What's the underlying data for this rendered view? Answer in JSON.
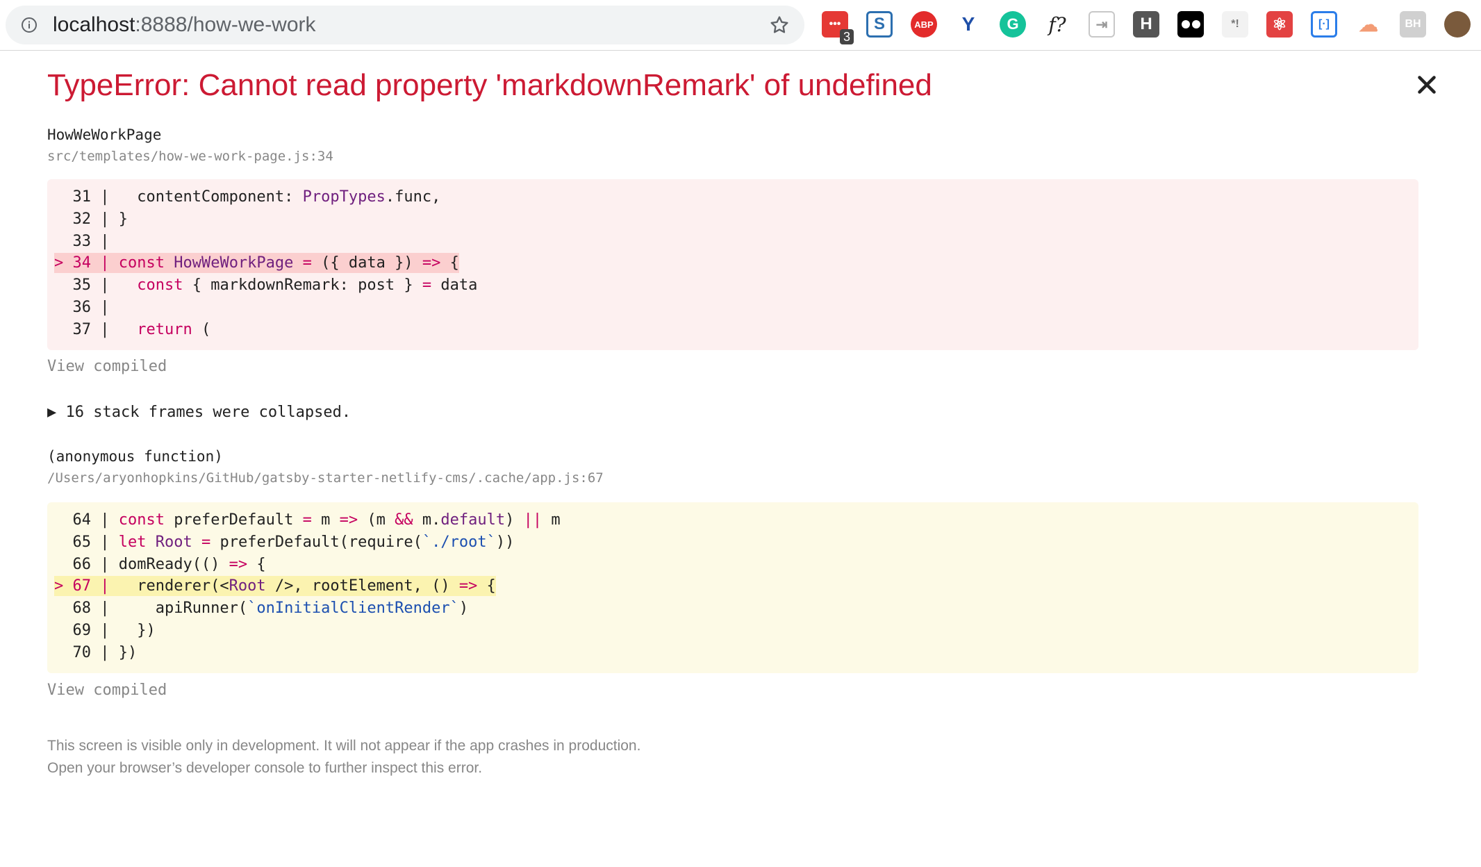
{
  "browser": {
    "url_host": "localhost",
    "url_rest": ":8888/how-we-work",
    "extension_badge": "3",
    "extensions": [
      "ext-meetup-icon",
      "ext-s-icon",
      "ext-abp-icon",
      "ext-y-icon",
      "ext-grammarly-icon",
      "ext-f-icon",
      "ext-arrow-icon",
      "ext-h-icon",
      "ext-tampermonkey-icon",
      "ext-regex-icon",
      "ext-react-icon",
      "ext-bracket-icon",
      "ext-cloud-icon",
      "ext-bh-icon",
      "ext-avatar-icon"
    ],
    "labels": {
      "abp": "ABP",
      "f": "f?",
      "h": "H",
      "regex": "*!",
      "bh": "BH"
    }
  },
  "error": {
    "title": "TypeError: Cannot read property 'markdownRemark' of undefined",
    "close_label": "×"
  },
  "frames": [
    {
      "function": "HowWeWorkPage",
      "path": "src/templates/how-we-work-page.js:34",
      "view_compiled": "View compiled",
      "lines": [
        {
          "num": "31",
          "marker": " ",
          "code": "   contentComponent: PropTypes.func,"
        },
        {
          "num": "32",
          "marker": " ",
          "code": " }"
        },
        {
          "num": "33",
          "marker": " ",
          "code": ""
        },
        {
          "num": "34",
          "marker": ">",
          "code": " const HowWeWorkPage = ({ data }) => {"
        },
        {
          "num": "35",
          "marker": " ",
          "code": "   const { markdownRemark: post } = data"
        },
        {
          "num": "36",
          "marker": " ",
          "code": ""
        },
        {
          "num": "37",
          "marker": " ",
          "code": "   return ("
        }
      ]
    },
    {
      "function": "(anonymous function)",
      "path": "/Users/aryonhopkins/GitHub/gatsby-starter-netlify-cms/.cache/app.js:67",
      "view_compiled": "View compiled",
      "lines": [
        {
          "num": "64",
          "marker": " ",
          "code": " const preferDefault = m => (m && m.default) || m"
        },
        {
          "num": "65",
          "marker": " ",
          "code": " let Root = preferDefault(require(`./root`))"
        },
        {
          "num": "66",
          "marker": " ",
          "code": " domReady(() => {"
        },
        {
          "num": "67",
          "marker": ">",
          "code": "   renderer(<Root />, rootElement, () => {"
        },
        {
          "num": "68",
          "marker": " ",
          "code": "     apiRunner(`onInitialClientRender`)"
        },
        {
          "num": "69",
          "marker": " ",
          "code": "   })"
        },
        {
          "num": "70",
          "marker": " ",
          "code": " })"
        }
      ]
    }
  ],
  "collapsed": "▶ 16 stack frames were collapsed.",
  "footer": {
    "line1": "This screen is visible only in development. It will not appear if the app crashes in production.",
    "line2": "Open your browser’s developer console to further inspect this error."
  },
  "colors": {
    "error_red": "#cc1a33",
    "red_block": "#fdf0f0",
    "yellow_block": "#fdfae6",
    "muted": "#878787"
  }
}
